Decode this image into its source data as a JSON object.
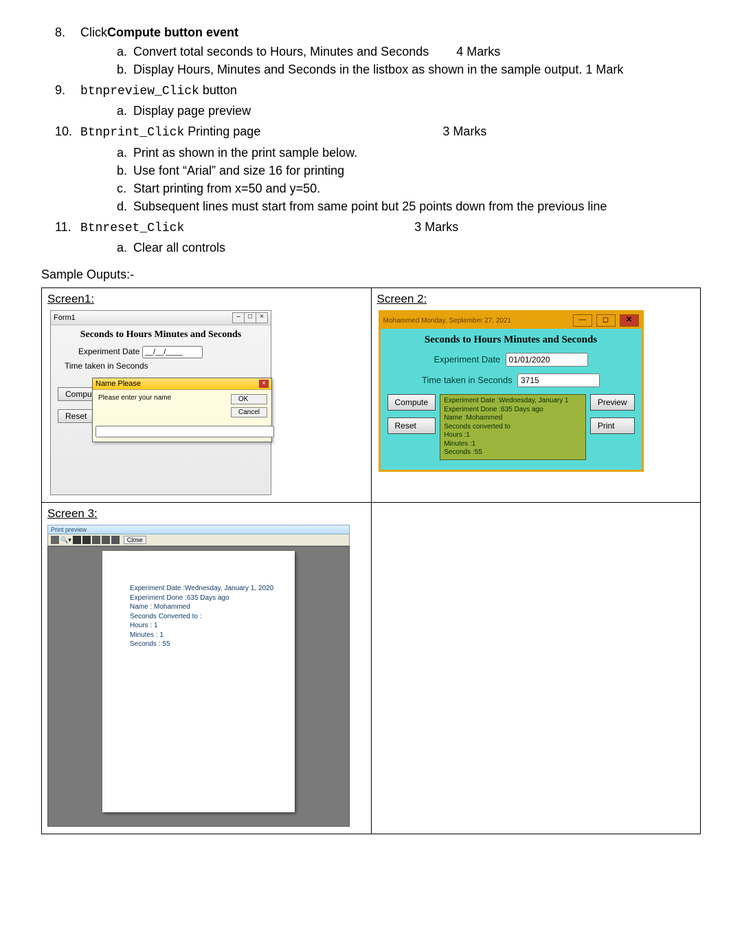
{
  "items": [
    {
      "n": "8.",
      "title_pre": "Click",
      "title_bold": "Compute button event",
      "subs": [
        {
          "lt": "a.",
          "txt": "Convert total seconds to Hours, Minutes and Seconds",
          "marks": "4 Marks"
        },
        {
          "lt": "b.",
          "txt": "Display Hours, Minutes and Seconds in the listbox  as shown in the sample output.  1 Mark"
        }
      ]
    },
    {
      "n": "9.",
      "mono": "btnpreview_Click",
      "after": " button",
      "subs": [
        {
          "lt": "a.",
          "txt": "Display page preview"
        }
      ]
    },
    {
      "n": "10.",
      "mono": "Btnprint_Click",
      "after": " Printing page",
      "marks": "3 Marks",
      "subs": [
        {
          "lt": "a.",
          "txt": "Print as shown in the print sample below."
        },
        {
          "lt": "b.",
          "txt": "Use font “Arial” and size 16 for printing"
        },
        {
          "lt": "c.",
          "txt": "Start printing from x=50 and y=50."
        },
        {
          "lt": "d.",
          "txt": "Subsequent lines must start from same point but 25 points down from the previous line"
        }
      ]
    },
    {
      "n": "11.",
      "mono": "Btnreset_Click",
      "marks": "3 Marks",
      "subs": [
        {
          "lt": "a.",
          "txt": "Clear all controls"
        }
      ]
    }
  ],
  "sample_label": "Sample Ouputs:-",
  "screen1": {
    "label": "Screen1:",
    "title": "Form1",
    "header": "Seconds to Hours Minutes and Seconds",
    "f1": "Experiment Date",
    "f1v": "__/__/____",
    "f2": "Time taken in Seconds",
    "compute": "Compute",
    "reset": "Reset",
    "dlg_title": "Name Please",
    "dlg_prompt": "Please enter your name",
    "ok": "OK",
    "cancel": "Cancel"
  },
  "screen2": {
    "label": "Screen 2:",
    "title": "Mohammed Monday, September 27, 2021",
    "header": "Seconds to Hours Minutes and Seconds",
    "f1": "Experiment Date",
    "f1v": "01/01/2020",
    "f2": "Time taken in Seconds",
    "f2v": "3715",
    "compute": "Compute",
    "reset": "Reset",
    "preview": "Preview",
    "print": "Print",
    "list": [
      "Experiment Date :Wednesday, January 1",
      "Experiment Done :635 Days ago",
      "Name :Mohammed",
      "Seconds converted to",
      "Hours :1",
      "Minutes :1",
      "Seconds :55"
    ]
  },
  "screen3": {
    "label": "Screen 3:",
    "title": "Print preview",
    "close": "Close",
    "lines": [
      "Experiment Date :Wednesday, January 1, 2020",
      "Experiment Done :635 Days ago",
      "Name : Mohammed",
      "Seconds Converted to :",
      "Hours : 1",
      "Minutes : 1",
      "Seconds : 55"
    ]
  }
}
